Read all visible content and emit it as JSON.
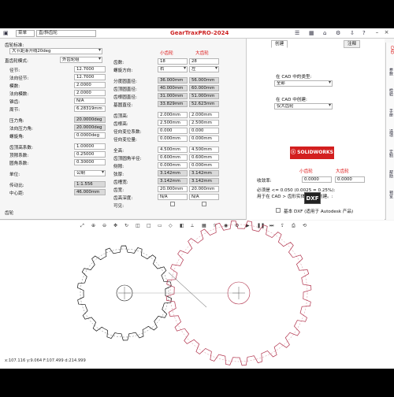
{
  "titlebar": {
    "menu1": "菜单",
    "menu2": "直/斜齿轮",
    "app_title": "GearTraxPRO-2024"
  },
  "left_form": {
    "standard_label": "齿轮标准:",
    "standard_value": "大节距渐开线20deg",
    "mode_label": "直齿轮模式:",
    "mode_value": "外齿轮组",
    "fields": [
      {
        "label": "径节:",
        "value": "12.7000"
      },
      {
        "label": "法向径节:",
        "value": "12.7000"
      },
      {
        "label": "模数:",
        "value": "2.0000"
      },
      {
        "label": "法向模数:",
        "value": "2.0000"
      },
      {
        "label": "锥齿:",
        "value": "N/A"
      },
      {
        "label": "周节:",
        "value": "6.28319mm"
      },
      {
        "label": "压力角:",
        "value": "20.0000deg"
      },
      {
        "label": "法向压力角:",
        "value": "20.0000deg"
      },
      {
        "label": "螺旋角:",
        "value": "0.0000deg"
      },
      {
        "label": "齿顶高系数:",
        "value": "1.00000"
      },
      {
        "label": "顶隙系数:",
        "value": "0.25000"
      },
      {
        "label": "圆角系数:",
        "value": "0.30000"
      },
      {
        "label": "单位:",
        "value": "公制"
      },
      {
        "label": "传动比:",
        "value": "1:1.556"
      },
      {
        "label": "中心距:",
        "value": "46.000mm"
      }
    ],
    "footer_label": "齿轮"
  },
  "mid_form": {
    "small_gear": "小齿轮",
    "large_gear": "大齿轮",
    "teeth_label": "齿数:",
    "teeth_small": "18",
    "teeth_large": "28",
    "helix_label": "螺旋方向:",
    "helix_small": "右",
    "helix_large": "左",
    "rows": [
      {
        "label": "分度圆直径:",
        "small": "36.000mm",
        "large": "56.000mm"
      },
      {
        "label": "齿顶圆直径:",
        "small": "40.000mm",
        "large": "60.000mm"
      },
      {
        "label": "齿根圆直径:",
        "small": "31.000mm",
        "large": "51.000mm"
      },
      {
        "label": "基圆直径:",
        "small": "33.829mm",
        "large": "52.623mm"
      },
      {
        "label": "齿顶高:",
        "small": "2.000mm",
        "large": "2.000mm"
      },
      {
        "label": "齿根高:",
        "small": "2.500mm",
        "large": "2.500mm"
      },
      {
        "label": "径向变位系数:",
        "small": "0.000",
        "large": "0.000"
      },
      {
        "label": "径向变位量:",
        "small": "0.000mm",
        "large": "0.000mm"
      },
      {
        "label": "全高:",
        "small": "4.500mm",
        "large": "4.500mm"
      },
      {
        "label": "齿顶圆角半径:",
        "small": "0.600mm",
        "large": "0.600mm"
      },
      {
        "label": "侧隙:",
        "small": "0.000mm",
        "large": "0.000mm"
      },
      {
        "label": "弦厚:",
        "small": "3.142mm",
        "large": "3.142mm"
      },
      {
        "label": "齿槽宽:",
        "small": "3.142mm",
        "large": "3.142mm"
      },
      {
        "label": "齿宽:",
        "small": "20.000mm",
        "large": "20.000mm"
      },
      {
        "label": "齿高深度:",
        "small": "N/A",
        "large": "N/A"
      }
    ],
    "visible_label": "可见:"
  },
  "right_panel": {
    "tab_create": "创建",
    "tab_notes": "注释",
    "cad_type_label": "在 CAD 中的类型:",
    "cad_type_value": "全部",
    "cad_create_label": "在 CAD 中创建:",
    "cad_create_value": "仅大齿轮",
    "solidworks_label": "SOLIDWORKS",
    "small_gear": "小齿轮",
    "large_gear": "大齿轮",
    "convergence_label": "收敛率:",
    "convergence_small": "0.0000",
    "convergence_large": "0.0000",
    "note_line1": "必须是 <= 0.050 (0.0025 = 0.25%):",
    "note_line2": "用于在 CAD > 齿形实体选项中创建。:",
    "dxf_label": "DXF",
    "dxf_checkbox_label": "基本 DXF (适用于 Autodesk 产品)"
  },
  "right_strip": [
    "CAD",
    "参数",
    "检验",
    "手册",
    "选项",
    "定制",
    "帮助",
    "预览"
  ],
  "canvas": {
    "status_text": "x:107.116  y:9.064  F:107.499  d:214.999"
  },
  "colors": {
    "title_red": "#cc1f1f",
    "small_gear_stroke": "#111111",
    "large_gear_stroke": "#b0304a"
  }
}
